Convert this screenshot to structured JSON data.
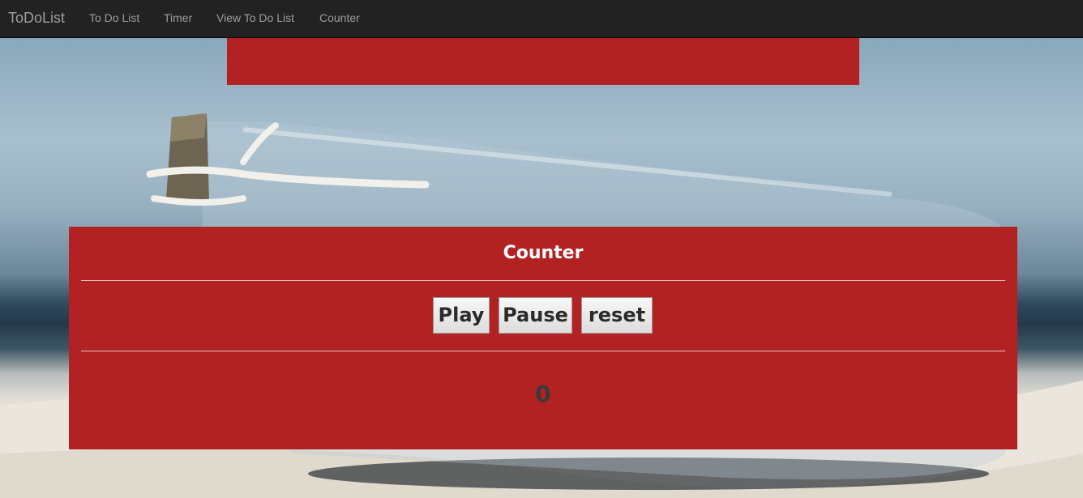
{
  "navbar": {
    "brand": "ToDoList",
    "links": [
      "To Do List",
      "Timer",
      "View To Do List",
      "Counter"
    ]
  },
  "counter": {
    "title": "Counter",
    "buttons": {
      "play": "Play",
      "pause": "Pause",
      "reset": "reset"
    },
    "value": "0"
  },
  "colors": {
    "panel": "#b22222",
    "navbar": "#222222"
  }
}
